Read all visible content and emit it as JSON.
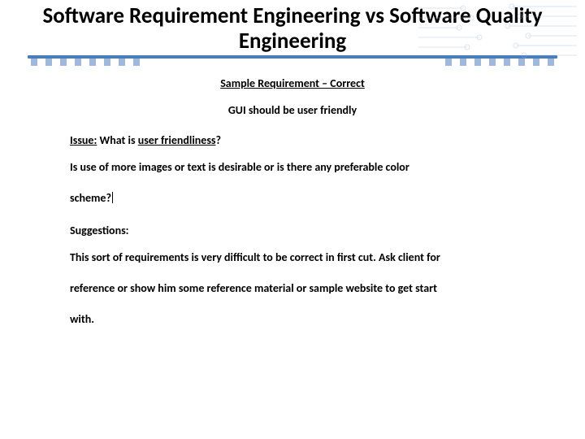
{
  "title": "Software Requirement Engineering vs Software Quality Engineering",
  "sample": {
    "heading": "Sample Requirement – Correct",
    "requirement": "GUI should be user friendly"
  },
  "issue": {
    "label": "Issue:",
    "prefix": " What is ",
    "term": "user friendliness",
    "suffix": "?"
  },
  "question": {
    "line1": "Is use of more images or text is desirable or is there any preferable color",
    "line2": "scheme?"
  },
  "suggestions": {
    "label": "Suggestions:",
    "line1": "This sort of requirements is very difficult to be correct in first cut. Ask client for",
    "line2": "reference or show him some reference material or sample website to get start",
    "line3": "with."
  }
}
